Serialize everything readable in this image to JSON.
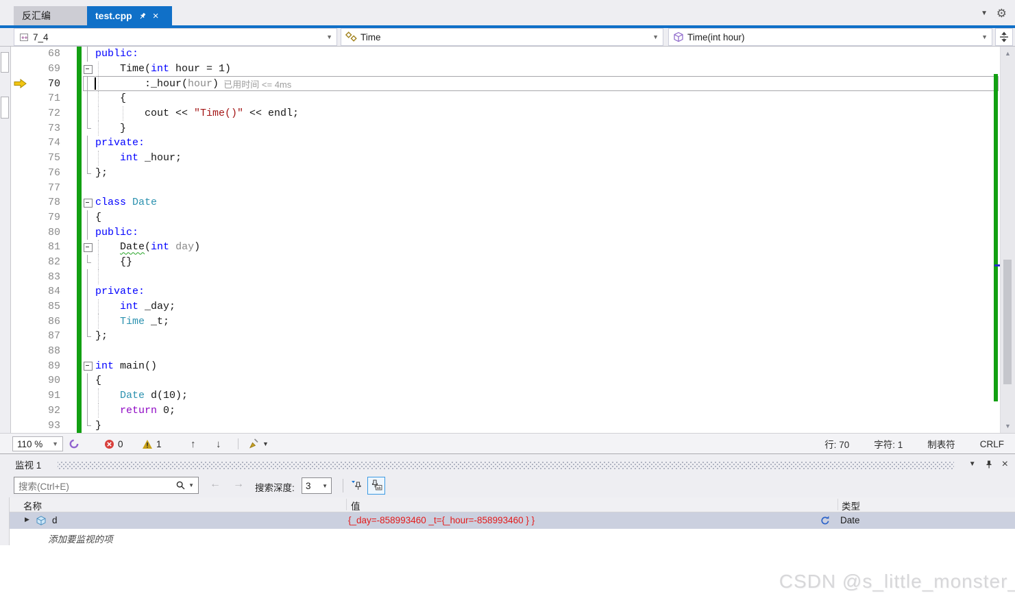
{
  "tab_strip": {
    "tabs": [
      {
        "label": "反汇编",
        "active": false
      },
      {
        "label": "test.cpp",
        "active": true
      }
    ]
  },
  "navbar": {
    "project": "7_4",
    "type": "Time",
    "member": "Time(int hour)"
  },
  "editor": {
    "lines": [
      {
        "n": 68,
        "f": "line",
        "t": [
          [
            "public:",
            "kw"
          ]
        ]
      },
      {
        "n": 69,
        "f": "box",
        "g": [
          0
        ],
        "t": [
          [
            "    Time(",
            "pl"
          ],
          [
            "int",
            "kw"
          ],
          [
            " hour = 1)",
            "pl"
          ]
        ]
      },
      {
        "n": 70,
        "f": "line",
        "g": [
          0
        ],
        "cur": true,
        "t": [
          [
            "        :_hour(",
            "pl"
          ],
          [
            "hour",
            "pa"
          ],
          [
            ")",
            "pl"
          ],
          [
            "  已用时间 <= 4ms",
            "tip"
          ]
        ]
      },
      {
        "n": 71,
        "f": "line",
        "g": [
          0
        ],
        "t": [
          [
            "    {",
            "pl"
          ]
        ]
      },
      {
        "n": 72,
        "f": "line",
        "g": [
          0,
          1
        ],
        "t": [
          [
            "        cout << ",
            "pl"
          ],
          [
            "\"Time()\"",
            "st"
          ],
          [
            " << endl;",
            "pl"
          ]
        ]
      },
      {
        "n": 73,
        "f": "end",
        "g": [
          0
        ],
        "t": [
          [
            "    }",
            "pl"
          ]
        ]
      },
      {
        "n": 74,
        "f": "line",
        "t": [
          [
            "private:",
            "kw"
          ]
        ]
      },
      {
        "n": 75,
        "f": "line",
        "g": [
          0
        ],
        "t": [
          [
            "    ",
            "pl"
          ],
          [
            "int",
            "kw"
          ],
          [
            " _hour;",
            "pl"
          ]
        ]
      },
      {
        "n": 76,
        "f": "end",
        "t": [
          [
            "};",
            "pl"
          ]
        ]
      },
      {
        "n": 77,
        "t": []
      },
      {
        "n": 78,
        "f": "box",
        "t": [
          [
            "class",
            "kw"
          ],
          [
            " ",
            "pl"
          ],
          [
            "Date",
            "ty"
          ]
        ]
      },
      {
        "n": 79,
        "f": "line",
        "t": [
          [
            "{",
            "pl"
          ]
        ]
      },
      {
        "n": 80,
        "f": "line",
        "t": [
          [
            "public:",
            "kw"
          ]
        ]
      },
      {
        "n": 81,
        "f": "box",
        "g": [
          0
        ],
        "t": [
          [
            "    ",
            "pl"
          ],
          [
            "Date",
            "sq"
          ],
          [
            "(",
            "pl"
          ],
          [
            "int",
            "kw"
          ],
          [
            " ",
            "pl"
          ],
          [
            "day",
            "pa"
          ],
          [
            ")",
            "pl"
          ]
        ]
      },
      {
        "n": 82,
        "f": "end",
        "g": [
          0
        ],
        "t": [
          [
            "    {}",
            "pl"
          ]
        ]
      },
      {
        "n": 83,
        "f": "line",
        "g": [
          0
        ],
        "t": []
      },
      {
        "n": 84,
        "f": "line",
        "t": [
          [
            "private:",
            "kw"
          ]
        ]
      },
      {
        "n": 85,
        "f": "line",
        "g": [
          0
        ],
        "t": [
          [
            "    ",
            "pl"
          ],
          [
            "int",
            "kw"
          ],
          [
            " _day;",
            "pl"
          ]
        ]
      },
      {
        "n": 86,
        "f": "line",
        "g": [
          0
        ],
        "t": [
          [
            "    ",
            "pl"
          ],
          [
            "Time",
            "ty"
          ],
          [
            " _t;",
            "pl"
          ]
        ]
      },
      {
        "n": 87,
        "f": "end",
        "t": [
          [
            "};",
            "pl"
          ]
        ]
      },
      {
        "n": 88,
        "t": []
      },
      {
        "n": 89,
        "f": "box",
        "t": [
          [
            "int",
            "kw"
          ],
          [
            " main()",
            "pl"
          ]
        ]
      },
      {
        "n": 90,
        "f": "line",
        "t": [
          [
            "{",
            "pl"
          ]
        ]
      },
      {
        "n": 91,
        "f": "line",
        "g": [
          0
        ],
        "t": [
          [
            "    ",
            "pl"
          ],
          [
            "Date",
            "ty"
          ],
          [
            " d(10);",
            "pl"
          ]
        ]
      },
      {
        "n": 92,
        "f": "line",
        "g": [
          0
        ],
        "t": [
          [
            "    ",
            "pl"
          ],
          [
            "return",
            "ct"
          ],
          [
            " 0;",
            "pl"
          ]
        ]
      },
      {
        "n": 93,
        "f": "end",
        "t": [
          [
            "}",
            "pl"
          ]
        ]
      }
    ]
  },
  "editor_status": {
    "zoom": "110 %",
    "error_count": "0",
    "warning_count": "1",
    "line": "行: 70",
    "column": "字符: 1",
    "tabs": "制表符",
    "line_ending": "CRLF"
  },
  "watch": {
    "title": "监视 1",
    "search_placeholder": "搜索(Ctrl+E)",
    "depth_label": "搜索深度:",
    "depth_value": "3",
    "columns": [
      "名称",
      "值",
      "类型"
    ],
    "rows": [
      {
        "name": "d",
        "value": "{_day=-858993460 _t={_hour=-858993460 } }",
        "type": "Date"
      }
    ],
    "add_row_label": "添加要监视的项"
  },
  "watermark": "CSDN @s_little_monster_",
  "colors": {
    "active_tab_blue": "#1070c8",
    "change_tracking_green": "#12a012",
    "watch_value_red": "#e31b1b",
    "selection_row": "#cbd0df"
  },
  "icons": {
    "tab": [
      "pin-icon",
      "close-icon"
    ],
    "navbar": [
      "cpp-project-icon",
      "class-icon",
      "method-icon",
      "split-window-icon"
    ],
    "editor_status": [
      "code-health-icon",
      "error-icon",
      "warning-icon",
      "up-arrow-icon",
      "down-arrow-icon",
      "cleanup-broom-icon"
    ],
    "watch": [
      "search-icon",
      "back-icon",
      "forward-icon",
      "pin-filter-icon",
      "pin-ab-icon",
      "expander-icon",
      "object-icon",
      "refresh-icon",
      "window-position-icon",
      "pin-icon",
      "close-icon"
    ]
  }
}
